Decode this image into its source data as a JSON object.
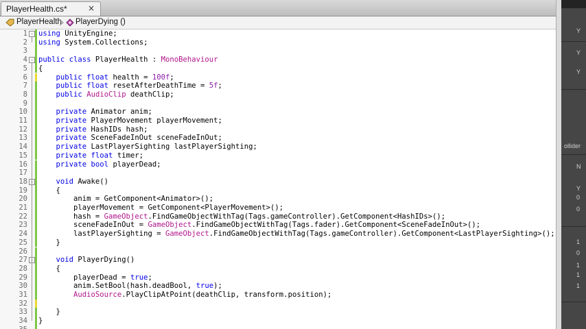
{
  "tab": {
    "title": "PlayerHealth.cs*",
    "close_symbol": "×"
  },
  "breadcrumb": {
    "class_name": "PlayerHealth",
    "method_name": "PlayerDying ()"
  },
  "right_panel": {
    "labels": [
      "Y",
      "Y",
      "Y",
      "ollider",
      "N",
      "Y",
      "0",
      "0",
      "1",
      "0",
      "1",
      "1",
      "1"
    ]
  },
  "lines": [
    {
      "n": "1",
      "fold": "-",
      "bar": "g",
      "toks": [
        [
          "kw",
          "using"
        ],
        [
          "p",
          " UnityEngine;"
        ]
      ]
    },
    {
      "n": "2",
      "bar": "g",
      "toks": [
        [
          "kw",
          "using"
        ],
        [
          "p",
          " System.Collections;"
        ]
      ]
    },
    {
      "n": "3",
      "bar": "g",
      "toks": []
    },
    {
      "n": "4",
      "fold": "-",
      "bar": "g",
      "toks": [
        [
          "kw",
          "public class"
        ],
        [
          "p",
          " PlayerHealth : "
        ],
        [
          "ty",
          "MonoBehaviour"
        ]
      ]
    },
    {
      "n": "5",
      "bar": "g",
      "toks": [
        [
          "p",
          "{"
        ]
      ]
    },
    {
      "n": "6",
      "bar": "y",
      "toks": [
        [
          "p",
          "    "
        ],
        [
          "kw",
          "public float"
        ],
        [
          "p",
          " health = "
        ],
        [
          "num",
          "100f"
        ],
        [
          "p",
          ";"
        ]
      ]
    },
    {
      "n": "7",
      "bar": "g",
      "toks": [
        [
          "p",
          "    "
        ],
        [
          "kw",
          "public float"
        ],
        [
          "p",
          " resetAfterDeathTime = "
        ],
        [
          "num",
          "5f"
        ],
        [
          "p",
          ";"
        ]
      ]
    },
    {
      "n": "8",
      "bar": "g",
      "toks": [
        [
          "p",
          "    "
        ],
        [
          "kw",
          "public"
        ],
        [
          "p",
          " "
        ],
        [
          "ty",
          "AudioClip"
        ],
        [
          "p",
          " deathClip;"
        ]
      ]
    },
    {
      "n": "9",
      "bar": "g",
      "toks": []
    },
    {
      "n": "10",
      "bar": "g",
      "toks": [
        [
          "p",
          "    "
        ],
        [
          "kw",
          "private"
        ],
        [
          "p",
          " Animator anim;"
        ]
      ]
    },
    {
      "n": "11",
      "bar": "g",
      "toks": [
        [
          "p",
          "    "
        ],
        [
          "kw",
          "private"
        ],
        [
          "p",
          " PlayerMovement playerMovement;"
        ]
      ]
    },
    {
      "n": "12",
      "bar": "g",
      "toks": [
        [
          "p",
          "    "
        ],
        [
          "kw",
          "private"
        ],
        [
          "p",
          " HashIDs hash;"
        ]
      ]
    },
    {
      "n": "13",
      "bar": "g",
      "toks": [
        [
          "p",
          "    "
        ],
        [
          "kw",
          "private"
        ],
        [
          "p",
          " SceneFadeInOut sceneFadeInOut;"
        ]
      ]
    },
    {
      "n": "14",
      "bar": "g",
      "toks": [
        [
          "p",
          "    "
        ],
        [
          "kw",
          "private"
        ],
        [
          "p",
          " LastPlayerSighting lastPlayerSighting;"
        ]
      ]
    },
    {
      "n": "15",
      "bar": "g",
      "toks": [
        [
          "p",
          "    "
        ],
        [
          "kw",
          "private float"
        ],
        [
          "p",
          " timer;"
        ]
      ]
    },
    {
      "n": "16",
      "bar": "g",
      "toks": [
        [
          "p",
          "    "
        ],
        [
          "kw",
          "private bool"
        ],
        [
          "p",
          " playerDead;"
        ]
      ]
    },
    {
      "n": "17",
      "bar": "g",
      "toks": []
    },
    {
      "n": "18",
      "fold": "-",
      "bar": "g",
      "toks": [
        [
          "p",
          "    "
        ],
        [
          "kw",
          "void"
        ],
        [
          "p",
          " Awake()"
        ]
      ]
    },
    {
      "n": "19",
      "bar": "g",
      "toks": [
        [
          "p",
          "    {"
        ]
      ]
    },
    {
      "n": "20",
      "bar": "g",
      "toks": [
        [
          "p",
          "        anim = GetComponent<Animator>();"
        ]
      ]
    },
    {
      "n": "21",
      "bar": "g",
      "toks": [
        [
          "p",
          "        playerMovement = GetComponent<PlayerMovement>();"
        ]
      ]
    },
    {
      "n": "22",
      "bar": "g",
      "toks": [
        [
          "p",
          "        hash = "
        ],
        [
          "ty",
          "GameObject"
        ],
        [
          "p",
          ".FindGameObjectWithTag(Tags.gameController).GetComponent<HashIDs>();"
        ]
      ]
    },
    {
      "n": "23",
      "bar": "g",
      "toks": [
        [
          "p",
          "        sceneFadeInOut = "
        ],
        [
          "ty",
          "GameObject"
        ],
        [
          "p",
          ".FindGameObjectWithTag(Tags.fader).GetComponent<SceneFadeInOut>();"
        ]
      ]
    },
    {
      "n": "24",
      "bar": "g",
      "toks": [
        [
          "p",
          "        lastPlayerSighting = "
        ],
        [
          "ty",
          "GameObject"
        ],
        [
          "p",
          ".FindGameObjectWithTag(Tags.gameController).GetComponent<LastPlayerSighting>();"
        ]
      ]
    },
    {
      "n": "25",
      "bar": "g",
      "toks": [
        [
          "p",
          "    }"
        ]
      ]
    },
    {
      "n": "26",
      "bar": "g",
      "toks": []
    },
    {
      "n": "27",
      "fold": "-",
      "bar": "g",
      "toks": [
        [
          "p",
          "    "
        ],
        [
          "kw",
          "void"
        ],
        [
          "p",
          " PlayerDying()"
        ]
      ]
    },
    {
      "n": "28",
      "bar": "g",
      "toks": [
        [
          "p",
          "    {"
        ]
      ]
    },
    {
      "n": "29",
      "bar": "g",
      "toks": [
        [
          "p",
          "        playerDead = "
        ],
        [
          "kw",
          "true"
        ],
        [
          "p",
          ";"
        ]
      ]
    },
    {
      "n": "30",
      "bar": "g",
      "toks": [
        [
          "p",
          "        anim.SetBool(hash.deadBool, "
        ],
        [
          "kw",
          "true"
        ],
        [
          "p",
          ");"
        ]
      ]
    },
    {
      "n": "31",
      "bar": "g",
      "toks": [
        [
          "p",
          "        "
        ],
        [
          "ty",
          "AudioSource"
        ],
        [
          "p",
          ".PlayClipAtPoint(deathClip, transform.position);"
        ]
      ]
    },
    {
      "n": "32",
      "bar": "y",
      "toks": []
    },
    {
      "n": "33",
      "bar": "g",
      "toks": [
        [
          "p",
          "    }"
        ]
      ]
    },
    {
      "n": "34",
      "bar": "g",
      "toks": [
        [
          "p",
          "}"
        ]
      ]
    },
    {
      "n": "35",
      "bar": "g",
      "toks": []
    }
  ],
  "colors": {
    "keyword": "#0000e6",
    "type": "#b0158b",
    "number": "#8b1ba8",
    "change_saved": "#7ec845",
    "change_unsaved": "#e8d936"
  }
}
